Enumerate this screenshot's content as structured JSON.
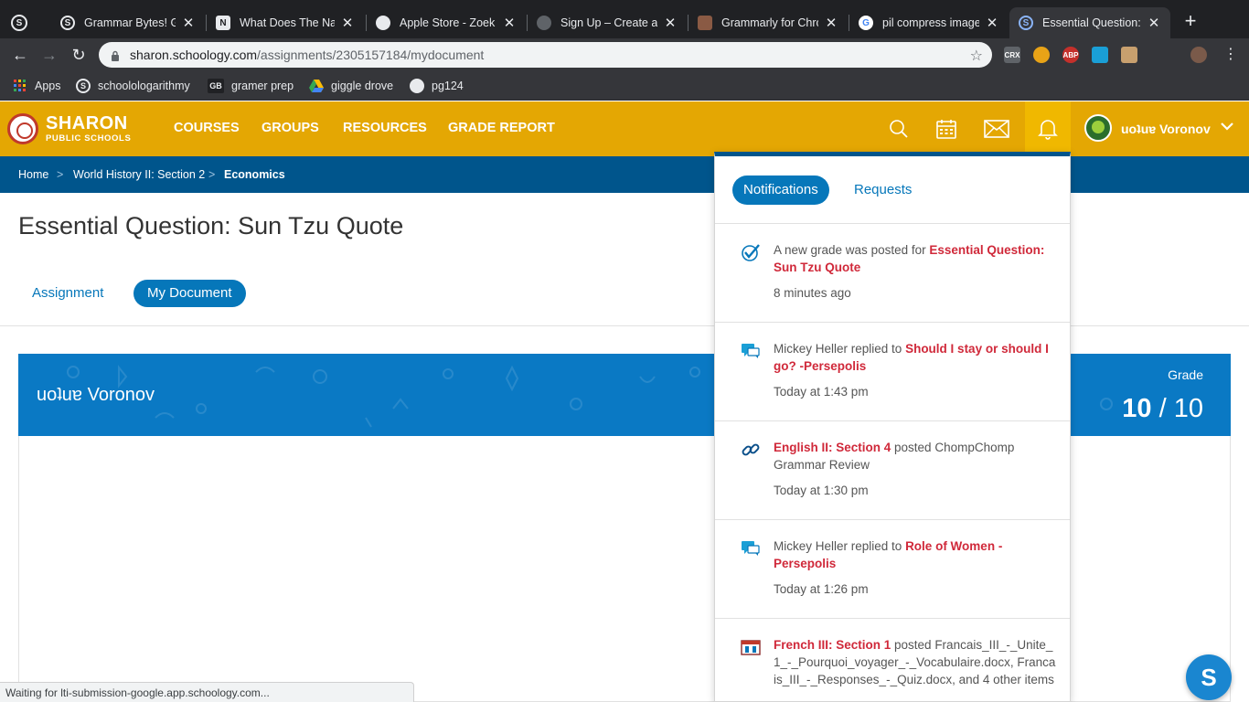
{
  "browser": {
    "tabs": [
      {
        "title": "Grammar Bytes! Gra",
        "icon": "schoology-icon"
      },
      {
        "title": "What Does The Nar",
        "icon": "n-icon"
      },
      {
        "title": "Apple Store - Zoek",
        "icon": "globe-icon"
      },
      {
        "title": "Sign Up – Create a I",
        "icon": "globe-icon"
      },
      {
        "title": "Grammarly for Chro",
        "icon": "store-icon"
      },
      {
        "title": "pil compress image",
        "icon": "google-icon"
      },
      {
        "title": "Essential Question:",
        "icon": "schoology-icon",
        "active": true
      }
    ],
    "url_host": "sharon.schoology.com",
    "url_path": "/assignments/2305157184/mydocument",
    "bookmarks": [
      {
        "label": "Apps"
      },
      {
        "label": "schoolologarithmy"
      },
      {
        "label": "gramer prep"
      },
      {
        "label": "giggle drove"
      },
      {
        "label": "pg124"
      }
    ],
    "extensions": [
      "CRX",
      "ABP"
    ],
    "status_text": "Waiting for lti-submission-google.app.schoology.com..."
  },
  "header": {
    "logo_line1": "SHARON",
    "logo_line2": "PUBLIC SCHOOLS",
    "nav": [
      "COURSES",
      "GROUPS",
      "RESOURCES",
      "GRADE REPORT"
    ],
    "user_name": "uoʇuɐ Voronov",
    "brand_color": "#e4a703"
  },
  "breadcrumb": {
    "items": [
      "Home",
      "World History II: Section 2",
      "Economics"
    ],
    "separator": ">"
  },
  "page": {
    "title": "Essential Question: Sun Tzu Quote",
    "tabs": [
      "Assignment",
      "My Document"
    ],
    "banner_name": "uoʇuɐ Voronov",
    "grade_label": "Grade",
    "grade_score": "10",
    "grade_sep": "/",
    "grade_total": "10"
  },
  "notifications": {
    "tabs": [
      "Notifications",
      "Requests"
    ],
    "items": [
      {
        "icon": "checkmark-icon",
        "prefix": "A new grade was posted for ",
        "link": "Essential Question: Sun Tzu Quote",
        "suffix": "",
        "time": "8 minutes ago"
      },
      {
        "icon": "comment-icon",
        "prefix": "Mickey Heller replied to ",
        "link": "Should I stay or should I go? -Persepolis",
        "suffix": "",
        "time": "Today at 1:43 pm"
      },
      {
        "icon": "link-icon",
        "prefix": "",
        "link": "English II: Section 4",
        "suffix": " posted ChompChomp Grammar Review",
        "time": "Today at 1:30 pm"
      },
      {
        "icon": "comment-icon",
        "prefix": "Mickey Heller replied to ",
        "link": "Role of Women - Persepolis",
        "suffix": "",
        "time": "Today at 1:26 pm"
      },
      {
        "icon": "folder-icon",
        "prefix": "",
        "link": "French III: Section 1",
        "suffix": " posted Francais_III_-_Unite_1_-_Pourquoi_voyager_-_Vocabulaire.docx, Francais_III_-_Responses_-_Quiz.docx, and 4 other items",
        "time": ""
      }
    ]
  },
  "fab_label": "S"
}
